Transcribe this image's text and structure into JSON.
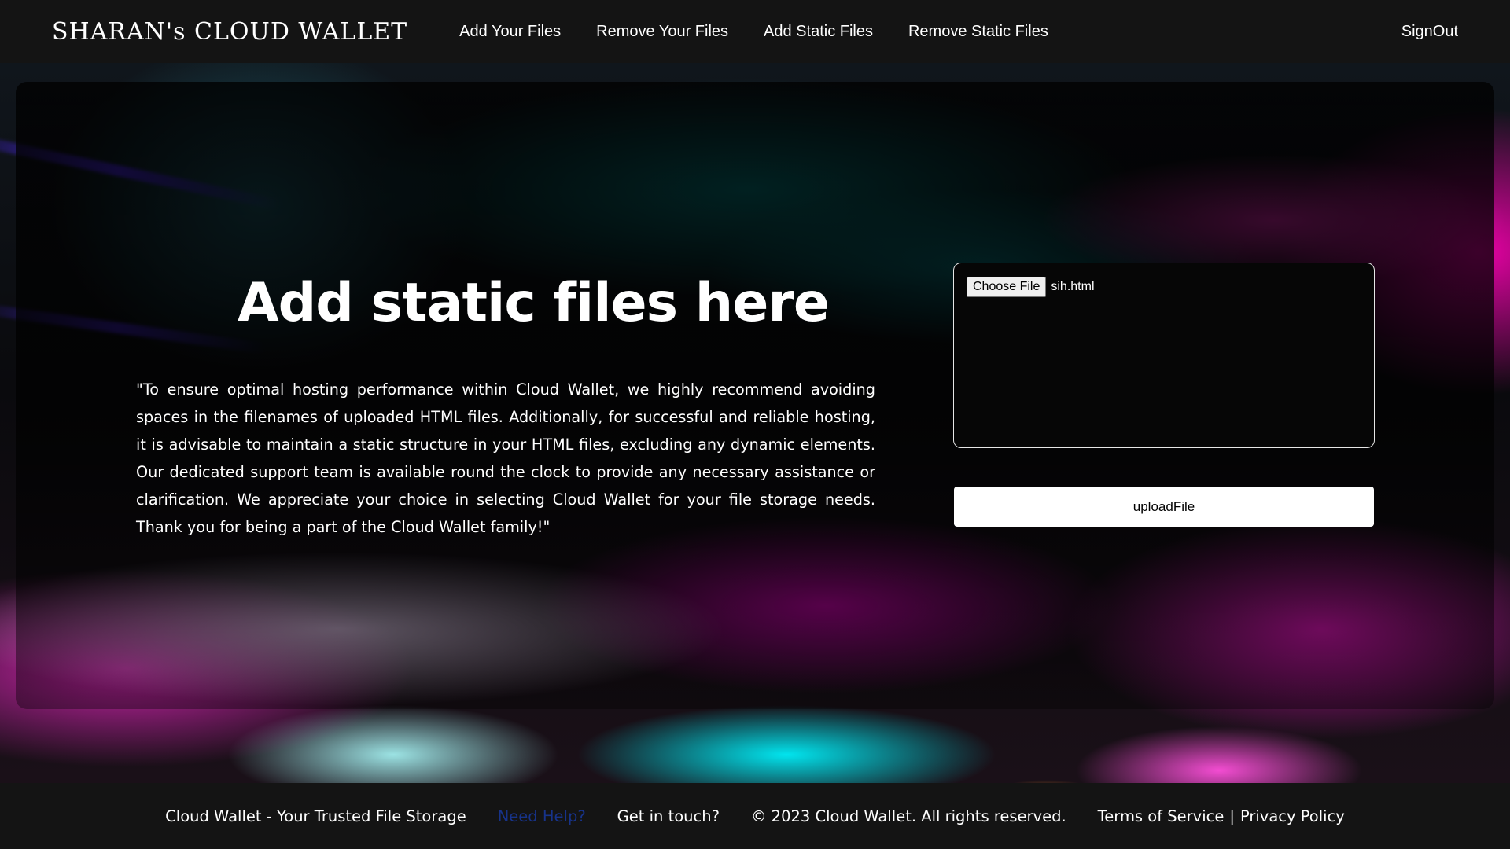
{
  "navbar": {
    "brand": "SHARAN's CLOUD WALLET",
    "links": [
      "Add Your Files",
      "Remove Your Files",
      "Add Static Files",
      "Remove Static Files"
    ],
    "signout": "SignOut"
  },
  "main": {
    "heading": "Add static files here",
    "notice": "\"To ensure optimal hosting performance within Cloud Wallet, we highly recommend avoiding spaces in the filenames of uploaded HTML files. Additionally, for successful and reliable hosting, it is advisable to maintain a static structure in your HTML files, excluding any dynamic elements. Our dedicated support team is available round the clock to provide any necessary assistance or clarification. We appreciate your choice in selecting Cloud Wallet for your file storage needs. Thank you for being a part of the Cloud Wallet family!\"",
    "file_input": {
      "button_label": "Choose File",
      "selected_file": "sih.html"
    },
    "upload_label": "uploadFile"
  },
  "footer": {
    "tagline": "Cloud Wallet - Your Trusted File Storage",
    "help": "Need Help?",
    "contact": "Get in touch?",
    "copyright": "© 2023 Cloud Wallet. All rights reserved.",
    "terms": "Terms of Service",
    "separator": "|",
    "privacy": "Privacy Policy"
  },
  "colors": {
    "nav_bg": "#141414",
    "help_link": "#17338a",
    "upload_button_bg": "#ffffff"
  }
}
